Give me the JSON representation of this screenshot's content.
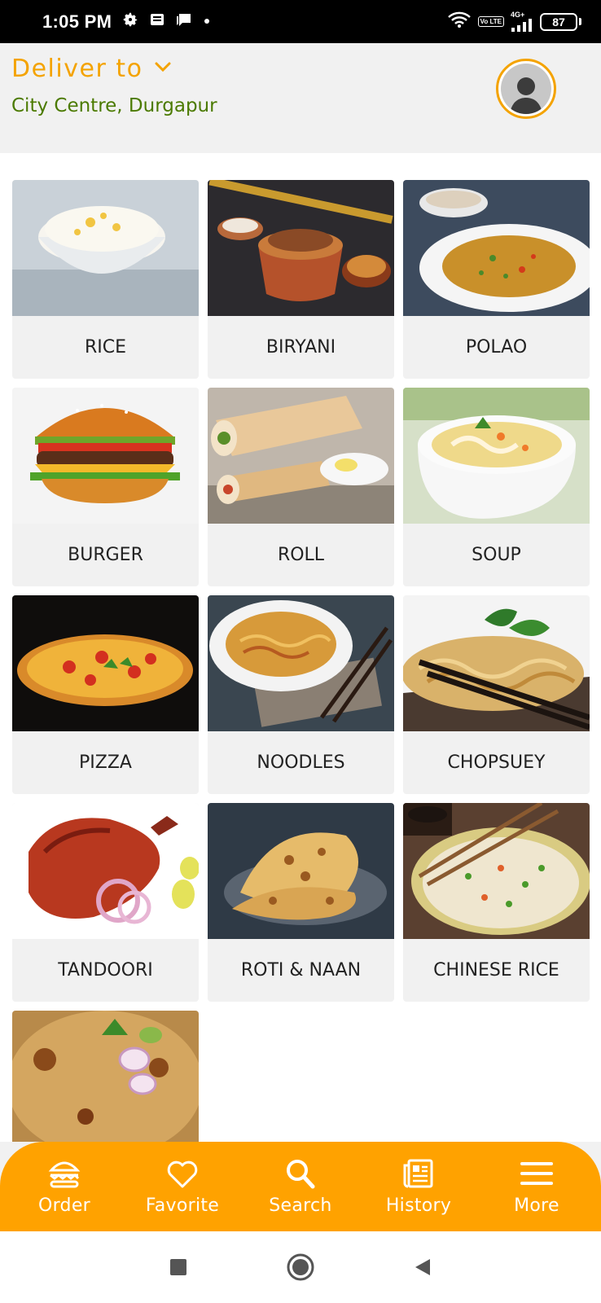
{
  "status_bar": {
    "time": "1:05 PM",
    "network": "4G+",
    "lte_badge": "Vo LTE",
    "battery": "87",
    "icons": [
      "gear-icon",
      "news-icon",
      "message-icon",
      "dot-icon",
      "wifi-icon",
      "signal-icon",
      "battery-icon"
    ]
  },
  "header": {
    "deliver_label": "Deliver to",
    "location": "City Centre, Durgapur",
    "accent_color": "#f4a300",
    "location_color": "#4b7a00"
  },
  "categories": [
    {
      "label": "RICE",
      "icon": "rice-bowl-image"
    },
    {
      "label": "BIRYANI",
      "icon": "biryani-pot-image"
    },
    {
      "label": "POLAO",
      "icon": "polao-plate-image"
    },
    {
      "label": "BURGER",
      "icon": "burger-image"
    },
    {
      "label": "ROLL",
      "icon": "roll-image"
    },
    {
      "label": "SOUP",
      "icon": "soup-bowl-image"
    },
    {
      "label": "PIZZA",
      "icon": "pizza-image"
    },
    {
      "label": "NOODLES",
      "icon": "noodles-image"
    },
    {
      "label": "CHOPSUEY",
      "icon": "chopsuey-image"
    },
    {
      "label": "TANDOORI",
      "icon": "tandoori-image"
    },
    {
      "label": "ROTI & NAAN",
      "icon": "naan-image"
    },
    {
      "label": "CHINESE RICE",
      "icon": "chinese-rice-image"
    },
    {
      "label": "",
      "icon": "biryani-plate-image"
    }
  ],
  "bottom_nav": {
    "color": "#ffa200",
    "items": [
      {
        "label": "Order",
        "icon": "burger-icon"
      },
      {
        "label": "Favorite",
        "icon": "heart-icon"
      },
      {
        "label": "Search",
        "icon": "search-icon"
      },
      {
        "label": "History",
        "icon": "newspaper-icon"
      },
      {
        "label": "More",
        "icon": "menu-icon"
      }
    ]
  },
  "system_nav": {
    "icons": [
      "recents-square-icon",
      "home-circle-icon",
      "back-triangle-icon"
    ]
  }
}
